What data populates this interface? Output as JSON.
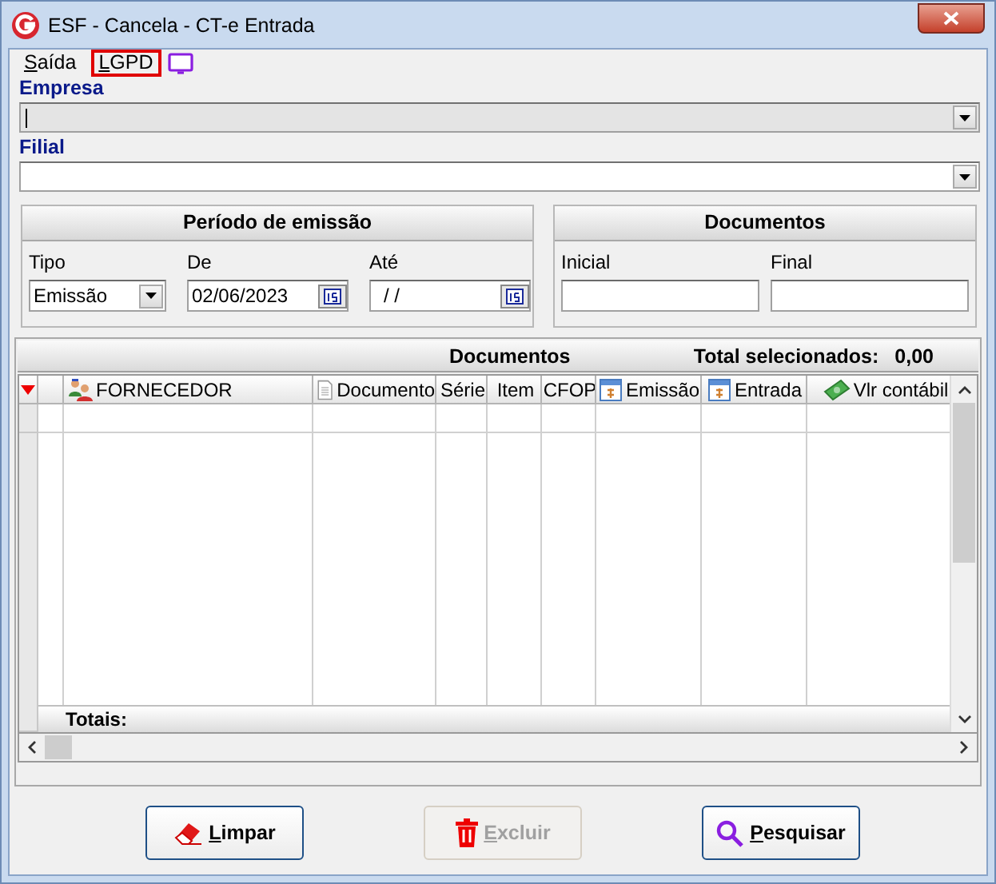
{
  "window": {
    "title": "ESF - Cancela - CT-e Entrada"
  },
  "menu": [
    {
      "label": "Saída",
      "highlighted": false
    },
    {
      "label": "LGPD",
      "highlighted": true
    }
  ],
  "empresa": {
    "label": "Empresa",
    "disabled": true
  },
  "filial": {
    "label": "Filial",
    "disabled": false
  },
  "periodo": {
    "title": "Período de emissão",
    "tipo": {
      "label": "Tipo",
      "value": "Emissão"
    },
    "de": {
      "label": "De",
      "value": "02/06/2023"
    },
    "ate": {
      "label": "Até",
      "value": "/ /"
    }
  },
  "documentos": {
    "title": "Documentos",
    "inicial": {
      "label": "Inicial"
    },
    "final": {
      "label": "Final"
    }
  },
  "grid": {
    "title": "Documentos",
    "total_label": "Total selecionados:",
    "total_value": "0,00",
    "totals_label": "Totais:",
    "columns": [
      {
        "label": "FORNECEDOR",
        "kind": "people"
      },
      {
        "label": "Documento",
        "kind": "document"
      },
      {
        "label": "Série",
        "kind": "plain"
      },
      {
        "label": "Item",
        "kind": "plain"
      },
      {
        "label": "CFOP",
        "kind": "plain"
      },
      {
        "label": "Emissão",
        "kind": "date"
      },
      {
        "label": "Entrada",
        "kind": "date"
      },
      {
        "label": "Vlr contábil",
        "kind": "money"
      }
    ]
  },
  "buttons": [
    {
      "label": "Limpar",
      "kind": "clear",
      "disabled": false
    },
    {
      "label": "Excluir",
      "kind": "delete",
      "disabled": true
    },
    {
      "label": "Pesquisar",
      "kind": "search",
      "disabled": false
    }
  ]
}
